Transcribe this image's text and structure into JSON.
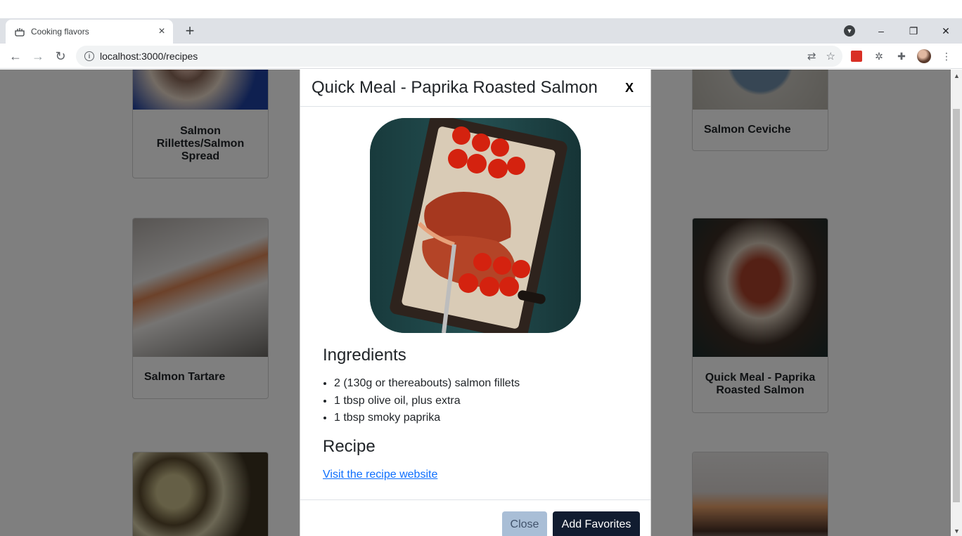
{
  "browser": {
    "tab_title": "Cooking flavors",
    "tab_close": "×",
    "new_tab": "+",
    "url": "localhost:3000/recipes",
    "win_minimize": "–",
    "win_restore": "❐",
    "win_close": "✕"
  },
  "cards": [
    {
      "title": "Salmon Rillettes/Salmon Spread"
    },
    {
      "title": "Salmon Ceviche"
    },
    {
      "title": "Salmon Tartare"
    },
    {
      "title": "Quick Meal - Paprika Roasted Salmon"
    }
  ],
  "modal": {
    "title": "Quick Meal - Paprika Roasted Salmon",
    "close_x": "X",
    "ingredients_heading": "Ingredients",
    "ingredients": [
      "2 (130g or thereabouts) salmon fillets",
      "1 tbsp olive oil, plus extra",
      "1 tbsp smoky paprika"
    ],
    "recipe_heading": "Recipe",
    "recipe_link": "Visit the recipe website",
    "close_button": "Close",
    "favorites_button": "Add Favorites"
  },
  "colors": {
    "link": "#0d6efd",
    "primary_button": "#111c30",
    "close_button": "#a9bed6"
  }
}
